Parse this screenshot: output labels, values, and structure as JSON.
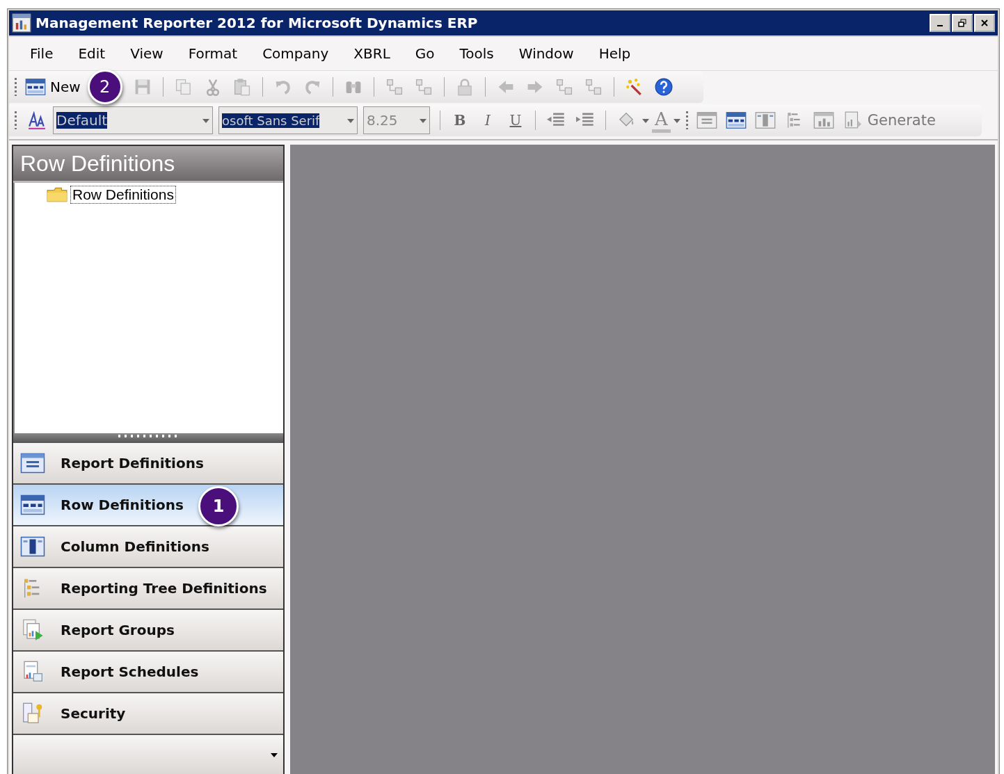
{
  "window": {
    "title": "Management Reporter 2012 for Microsoft Dynamics ERP"
  },
  "menu": [
    "File",
    "Edit",
    "View",
    "Format",
    "Company",
    "XBRL",
    "Go",
    "Tools",
    "Window",
    "Help"
  ],
  "toolbar": [
    {
      "kind": "new",
      "label": "New",
      "disabled": false,
      "callout": "2"
    },
    {
      "kind": "save",
      "disabled": true
    },
    {
      "kind": "sep"
    },
    {
      "kind": "copy",
      "disabled": true
    },
    {
      "kind": "cut",
      "disabled": true
    },
    {
      "kind": "paste",
      "disabled": true
    },
    {
      "kind": "sep"
    },
    {
      "kind": "undo",
      "disabled": true
    },
    {
      "kind": "redo",
      "disabled": true
    },
    {
      "kind": "sep"
    },
    {
      "kind": "find",
      "disabled": true
    },
    {
      "kind": "sep"
    },
    {
      "kind": "tree",
      "disabled": true
    },
    {
      "kind": "split",
      "disabled": true
    },
    {
      "kind": "sep"
    },
    {
      "kind": "lock",
      "disabled": true
    },
    {
      "kind": "sep"
    },
    {
      "kind": "back",
      "disabled": true
    },
    {
      "kind": "forward",
      "disabled": true
    },
    {
      "kind": "nodes",
      "disabled": true
    },
    {
      "kind": "nodes2",
      "disabled": true
    },
    {
      "kind": "sep"
    },
    {
      "kind": "wand",
      "disabled": false
    },
    {
      "kind": "help",
      "disabled": false
    }
  ],
  "format_bar": {
    "style_field": {
      "value": "Default"
    },
    "font_field": {
      "value": "osoft Sans Serif"
    },
    "size_field": {
      "value": "8.25",
      "disabled": true
    },
    "buttons": [
      {
        "kind": "sep"
      },
      {
        "kind": "bold",
        "label": "B"
      },
      {
        "kind": "italic",
        "label": "I"
      },
      {
        "kind": "underline",
        "label": "U"
      },
      {
        "kind": "sep"
      },
      {
        "kind": "outdent"
      },
      {
        "kind": "indent"
      },
      {
        "kind": "sep"
      },
      {
        "kind": "fill"
      },
      {
        "kind": "fontcolor",
        "label": "A"
      },
      {
        "kind": "grip"
      },
      {
        "kind": "report"
      },
      {
        "kind": "rows"
      },
      {
        "kind": "columns"
      },
      {
        "kind": "treelist"
      },
      {
        "kind": "chart"
      },
      {
        "kind": "generate",
        "label": "Generate"
      }
    ]
  },
  "panel": {
    "title": "Row Definitions",
    "tree": [
      {
        "label": "Row Definitions",
        "selected": true
      }
    ]
  },
  "nav": [
    {
      "label": "Report Definitions",
      "kind": "report",
      "selected": false
    },
    {
      "label": "Row Definitions",
      "kind": "rows",
      "selected": true,
      "callout": "1"
    },
    {
      "label": "Column Definitions",
      "kind": "columns",
      "selected": false
    },
    {
      "label": "Reporting Tree Definitions",
      "kind": "treelist",
      "selected": false
    },
    {
      "label": "Report Groups",
      "kind": "groups",
      "selected": false
    },
    {
      "label": "Report Schedules",
      "kind": "schedules",
      "selected": false
    },
    {
      "label": "Security",
      "kind": "security",
      "selected": false
    }
  ]
}
